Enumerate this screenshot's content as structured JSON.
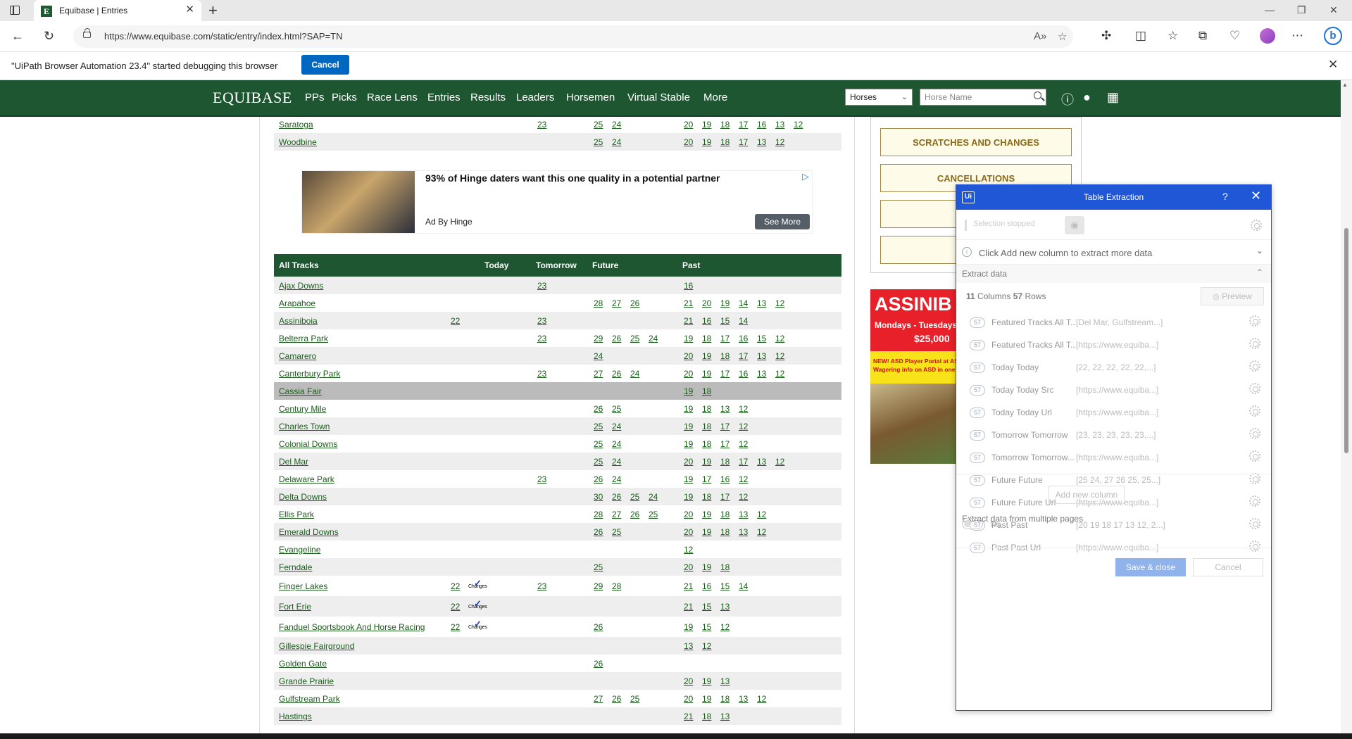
{
  "browser": {
    "tab_title": "Equibase | Entries",
    "url": "https://www.equibase.com/static/entry/index.html?SAP=TN",
    "debug_message": "\"UiPath Browser Automation 23.4\" started debugging this browser",
    "debug_cancel": "Cancel"
  },
  "nav": {
    "logo": "EQUIBASE",
    "items": [
      "PPs",
      "Picks",
      "Race Lens",
      "Entries",
      "Results",
      "Leaders",
      "Horsemen",
      "Virtual Stable",
      "More"
    ],
    "search_type": "Horses",
    "search_placeholder": "Horse Name"
  },
  "top_rows": [
    {
      "track": "Saratoga",
      "today": [],
      "tomorrow": [
        "23"
      ],
      "future": [
        "25",
        "24"
      ],
      "past": [
        "20",
        "19",
        "18",
        "17",
        "16",
        "13",
        "12"
      ]
    },
    {
      "track": "Woodbine",
      "today": [],
      "tomorrow": [],
      "future": [
        "25",
        "24"
      ],
      "past": [
        "20",
        "19",
        "18",
        "17",
        "13",
        "12"
      ]
    }
  ],
  "ad": {
    "title": "93% of Hinge daters want this one quality in a potential partner",
    "by": "Ad By Hinge",
    "cta": "See More"
  },
  "table": {
    "headers": {
      "track": "All Tracks",
      "today": "Today",
      "tomorrow": "Tomorrow",
      "future": "Future",
      "past": "Past"
    },
    "changes_label": "Changes",
    "rows": [
      {
        "track": "Ajax Downs",
        "today": [],
        "changes": false,
        "tomorrow": [
          "23"
        ],
        "future": [],
        "past": [
          "16"
        ]
      },
      {
        "track": "Arapahoe",
        "today": [],
        "changes": false,
        "tomorrow": [],
        "future": [
          "28",
          "27",
          "26"
        ],
        "past": [
          "21",
          "20",
          "19",
          "14",
          "13",
          "12"
        ]
      },
      {
        "track": "Assiniboia",
        "today": [
          "22"
        ],
        "changes": false,
        "tomorrow": [
          "23"
        ],
        "future": [],
        "past": [
          "21",
          "16",
          "15",
          "14"
        ]
      },
      {
        "track": "Belterra Park",
        "today": [],
        "changes": false,
        "tomorrow": [
          "23"
        ],
        "future": [
          "29",
          "26",
          "25",
          "24"
        ],
        "past": [
          "19",
          "18",
          "17",
          "16",
          "15",
          "12"
        ]
      },
      {
        "track": "Camarero",
        "today": [],
        "changes": false,
        "tomorrow": [],
        "future": [
          "24"
        ],
        "past": [
          "20",
          "19",
          "18",
          "17",
          "13",
          "12"
        ]
      },
      {
        "track": "Canterbury Park",
        "today": [],
        "changes": false,
        "tomorrow": [
          "23"
        ],
        "future": [
          "27",
          "26",
          "24"
        ],
        "past": [
          "20",
          "19",
          "17",
          "16",
          "13",
          "12"
        ]
      },
      {
        "track": "Cassia Fair",
        "today": [],
        "changes": false,
        "tomorrow": [],
        "future": [],
        "past": [
          "19",
          "18"
        ],
        "highlight": true
      },
      {
        "track": "Century Mile",
        "today": [],
        "changes": false,
        "tomorrow": [],
        "future": [
          "26",
          "25"
        ],
        "past": [
          "19",
          "18",
          "13",
          "12"
        ]
      },
      {
        "track": "Charles Town",
        "today": [],
        "changes": false,
        "tomorrow": [],
        "future": [
          "25",
          "24"
        ],
        "past": [
          "19",
          "18",
          "17",
          "12"
        ]
      },
      {
        "track": "Colonial Downs",
        "today": [],
        "changes": false,
        "tomorrow": [],
        "future": [
          "25",
          "24"
        ],
        "past": [
          "19",
          "18",
          "17",
          "12"
        ]
      },
      {
        "track": "Del Mar",
        "today": [],
        "changes": false,
        "tomorrow": [],
        "future": [
          "25",
          "24"
        ],
        "past": [
          "20",
          "19",
          "18",
          "17",
          "13",
          "12"
        ]
      },
      {
        "track": "Delaware Park",
        "today": [],
        "changes": false,
        "tomorrow": [
          "23"
        ],
        "future": [
          "26",
          "24"
        ],
        "past": [
          "19",
          "17",
          "16",
          "12"
        ]
      },
      {
        "track": "Delta Downs",
        "today": [],
        "changes": false,
        "tomorrow": [],
        "future": [
          "30",
          "26",
          "25",
          "24"
        ],
        "past": [
          "19",
          "18",
          "17",
          "12"
        ]
      },
      {
        "track": "Ellis Park",
        "today": [],
        "changes": false,
        "tomorrow": [],
        "future": [
          "28",
          "27",
          "26",
          "25"
        ],
        "past": [
          "20",
          "19",
          "18",
          "13",
          "12"
        ]
      },
      {
        "track": "Emerald Downs",
        "today": [],
        "changes": false,
        "tomorrow": [],
        "future": [
          "26",
          "25"
        ],
        "past": [
          "20",
          "19",
          "18",
          "13",
          "12"
        ]
      },
      {
        "track": "Evangeline",
        "today": [],
        "changes": false,
        "tomorrow": [],
        "future": [],
        "past": [
          "12"
        ]
      },
      {
        "track": "Ferndale",
        "today": [],
        "changes": false,
        "tomorrow": [],
        "future": [
          "25"
        ],
        "past": [
          "20",
          "19",
          "18"
        ]
      },
      {
        "track": "Finger Lakes",
        "today": [
          "22"
        ],
        "changes": true,
        "tomorrow": [
          "23"
        ],
        "future": [
          "29",
          "28"
        ],
        "past": [
          "21",
          "16",
          "15",
          "14"
        ]
      },
      {
        "track": "Fort Erie",
        "today": [
          "22"
        ],
        "changes": true,
        "tomorrow": [],
        "future": [],
        "past": [
          "21",
          "15",
          "13"
        ]
      },
      {
        "track": "Fanduel Sportsbook And Horse Racing",
        "today": [
          "22"
        ],
        "changes": true,
        "tomorrow": [],
        "future": [
          "26"
        ],
        "past": [
          "19",
          "15",
          "12"
        ]
      },
      {
        "track": "Gillespie Fairground",
        "today": [],
        "changes": false,
        "tomorrow": [],
        "future": [],
        "past": [
          "13",
          "12"
        ]
      },
      {
        "track": "Golden Gate",
        "today": [],
        "changes": false,
        "tomorrow": [],
        "future": [
          "26"
        ],
        "past": []
      },
      {
        "track": "Grande Prairie",
        "today": [],
        "changes": false,
        "tomorrow": [],
        "future": [],
        "past": [
          "20",
          "19",
          "13"
        ]
      },
      {
        "track": "Gulfstream Park",
        "today": [],
        "changes": false,
        "tomorrow": [],
        "future": [
          "27",
          "26",
          "25"
        ],
        "past": [
          "20",
          "19",
          "18",
          "13",
          "12"
        ]
      },
      {
        "track": "Hastings",
        "today": [],
        "changes": false,
        "tomorrow": [],
        "future": [],
        "past": [
          "21",
          "18",
          "13"
        ]
      }
    ]
  },
  "sidebar": {
    "buttons": [
      "SCRATCHES AND CHANGES",
      "CANCELLATIONS"
    ],
    "banner_title": "ASSINIB",
    "banner_sub": "Mondays - Tuesdays",
    "banner_amount": "$25,000",
    "banner_note1": "NEW! ASD Player Portal at ASD",
    "banner_note2": "Wagering info on ASD in one cl"
  },
  "uipath": {
    "title": "Table Extraction",
    "selection_status": "Selection stopped",
    "info": "Click Add new column to extract more data",
    "section": "Extract data",
    "columns_count": "11",
    "columns_label": "Columns",
    "rows_count": "57",
    "rows_label": "Rows",
    "preview": "Preview",
    "columns": [
      {
        "count": "57",
        "name": "Featured Tracks All T...",
        "value": "[Del Mar, Gulfstream...]"
      },
      {
        "count": "57",
        "name": "Featured Tracks All T...",
        "value": "[https://www.equiba...]"
      },
      {
        "count": "57",
        "name": "Today Today",
        "value": "[22, 22, 22, 22, 22,...]"
      },
      {
        "count": "57",
        "name": "Today Today Src",
        "value": "[https://www.equiba...]"
      },
      {
        "count": "57",
        "name": "Today Today Url",
        "value": "[https://www.equiba...]"
      },
      {
        "count": "57",
        "name": "Tomorrow Tomorrow",
        "value": "[23, 23, 23, 23, 23,...]"
      },
      {
        "count": "57",
        "name": "Tomorrow Tomorrow...",
        "value": "[https://www.equiba...]"
      },
      {
        "count": "57",
        "name": "Future Future",
        "value": "[25 24, 27 26 25, 25...]"
      },
      {
        "count": "57",
        "name": "Future Future Url",
        "value": "[https://www.equiba...]"
      },
      {
        "count": "57",
        "name": "Past Past",
        "value": "[20 19 18 17 13 12, 2...]"
      },
      {
        "count": "57",
        "name": "Past Past Url",
        "value": "[https://www.equiba...]"
      }
    ],
    "add_column": "Add new column",
    "multi_page_label": "Extract data from multiple pages",
    "multi_page_state": "No",
    "save": "Save & close",
    "cancel": "Cancel"
  }
}
